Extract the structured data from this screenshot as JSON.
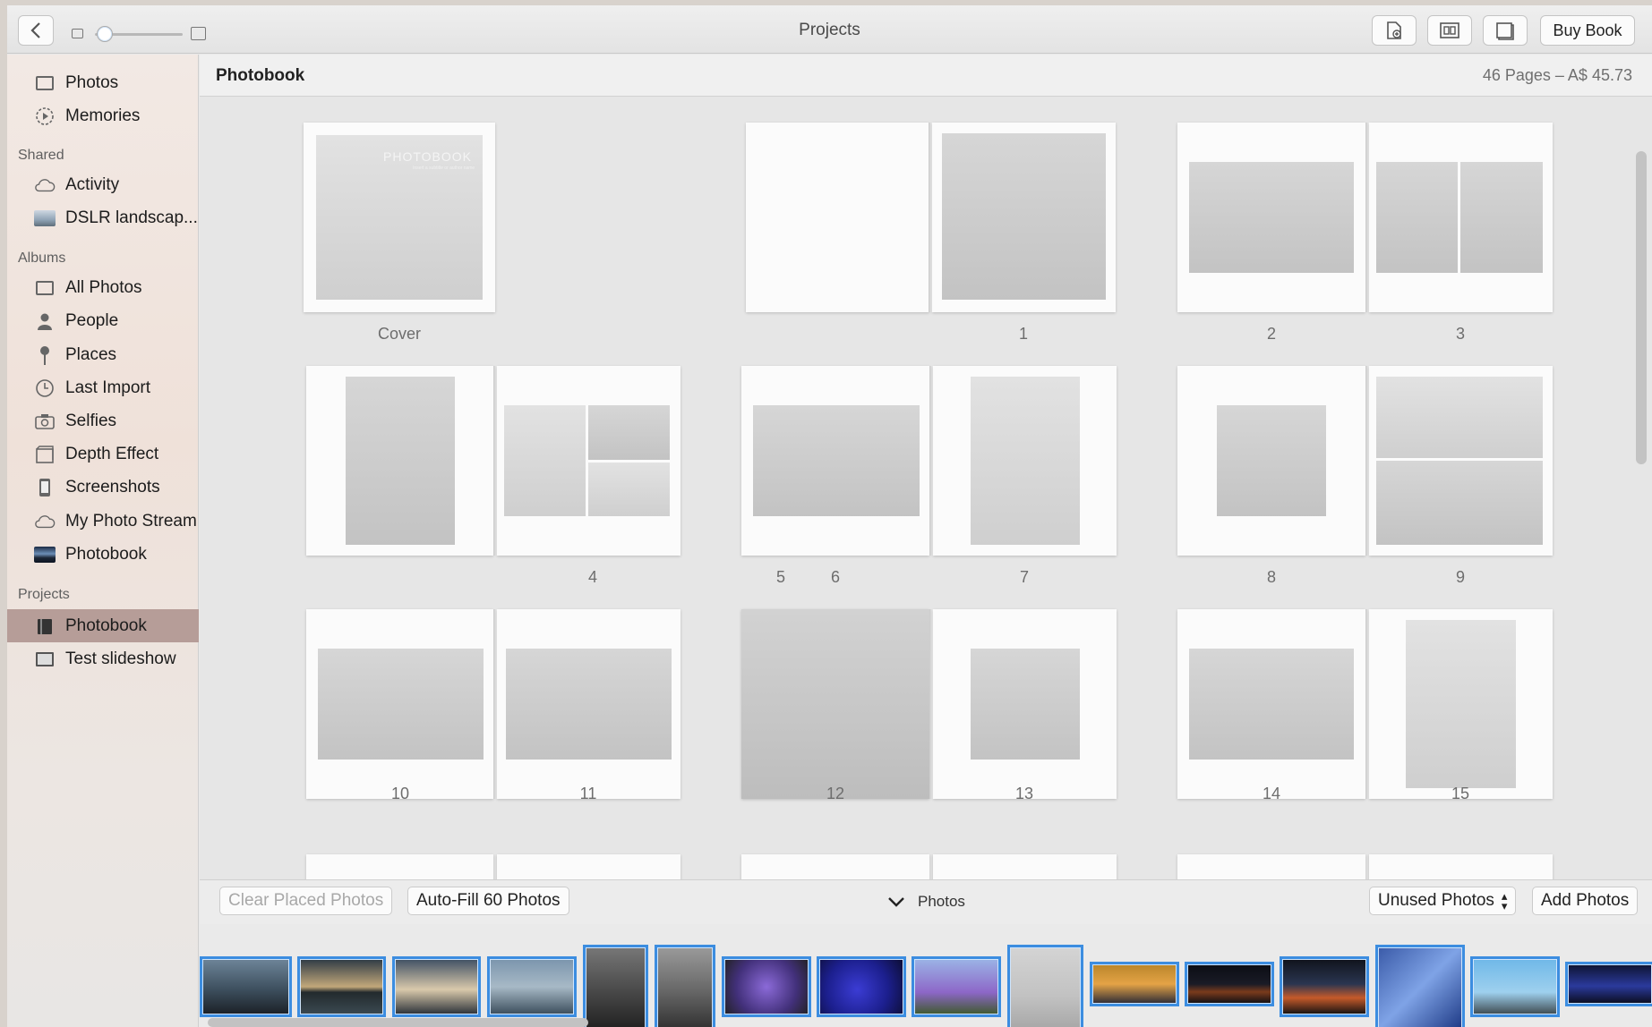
{
  "window": {
    "title": "Projects"
  },
  "toolbar": {
    "back_label": "‹",
    "buy_book_label": "Buy Book"
  },
  "sidebar": {
    "top_items": [
      {
        "label": "Photos",
        "icon": "photos-icon"
      },
      {
        "label": "Memories",
        "icon": "memories-icon"
      }
    ],
    "shared_heading": "Shared",
    "shared_items": [
      {
        "label": "Activity",
        "icon": "cloud-icon"
      },
      {
        "label": "DSLR landscap...",
        "icon": "album-thumbnail"
      }
    ],
    "albums_heading": "Albums",
    "album_items": [
      {
        "label": "All Photos",
        "icon": "photos-icon"
      },
      {
        "label": "People",
        "icon": "person-icon"
      },
      {
        "label": "Places",
        "icon": "pin-icon"
      },
      {
        "label": "Last Import",
        "icon": "clock-icon"
      },
      {
        "label": "Selfies",
        "icon": "camera-icon"
      },
      {
        "label": "Depth Effect",
        "icon": "cube-icon"
      },
      {
        "label": "Screenshots",
        "icon": "phone-icon"
      },
      {
        "label": "My Photo Stream",
        "icon": "cloud-icon"
      },
      {
        "label": "Photobook",
        "icon": "album-thumbnail"
      }
    ],
    "projects_heading": "Projects",
    "project_items": [
      {
        "label": "Photobook",
        "icon": "book-icon",
        "selected": true
      },
      {
        "label": "Test slideshow",
        "icon": "slideshow-icon"
      }
    ]
  },
  "content": {
    "title": "Photobook",
    "meta": "46 Pages – A$ 45.73",
    "cover": {
      "label": "Cover",
      "title": "PHOTOBOOK",
      "subtitle": "Insert a subtitle or author name"
    },
    "page_labels": [
      "1",
      "2",
      "3",
      "4",
      "5",
      "6",
      "7",
      "8",
      "9",
      "10",
      "11",
      "12",
      "13",
      "14",
      "15"
    ]
  },
  "tray": {
    "clear_label": "Clear Placed Photos",
    "autofill_label": "Auto-Fill 60 Photos",
    "photos_label": "Photos",
    "filter_label": "Unused Photos",
    "add_label": "Add Photos"
  },
  "colors": {
    "selection": "#b69d98",
    "thumb_border": "#3c8de0"
  }
}
